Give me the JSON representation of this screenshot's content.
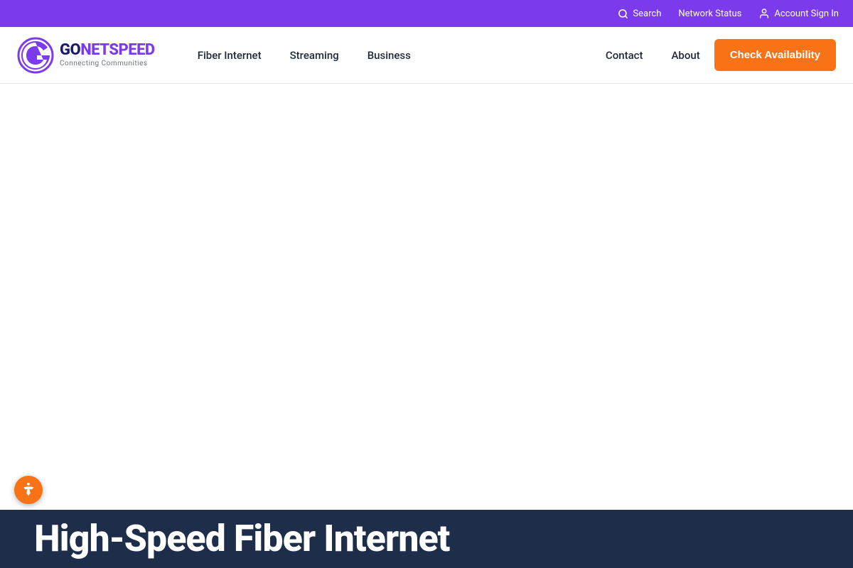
{
  "utility_bar": {
    "search_placeholder": "Search",
    "search_label": "Search",
    "network_status_label": "Network Status",
    "account_sign_in_label": "Account Sign In"
  },
  "main_nav": {
    "logo_brand_prefix": "GO",
    "logo_brand_suffix": "NETSPEED",
    "logo_tagline": "Connecting Communities",
    "nav_links": [
      {
        "label": "Fiber Internet",
        "id": "fiber-internet"
      },
      {
        "label": "Streaming",
        "id": "streaming"
      },
      {
        "label": "Business",
        "id": "business"
      },
      {
        "label": "Contact",
        "id": "contact"
      },
      {
        "label": "About",
        "id": "about"
      }
    ],
    "check_availability_label": "Check Availability"
  },
  "bottom_section": {
    "heading": "High-Speed Fiber Internet"
  }
}
